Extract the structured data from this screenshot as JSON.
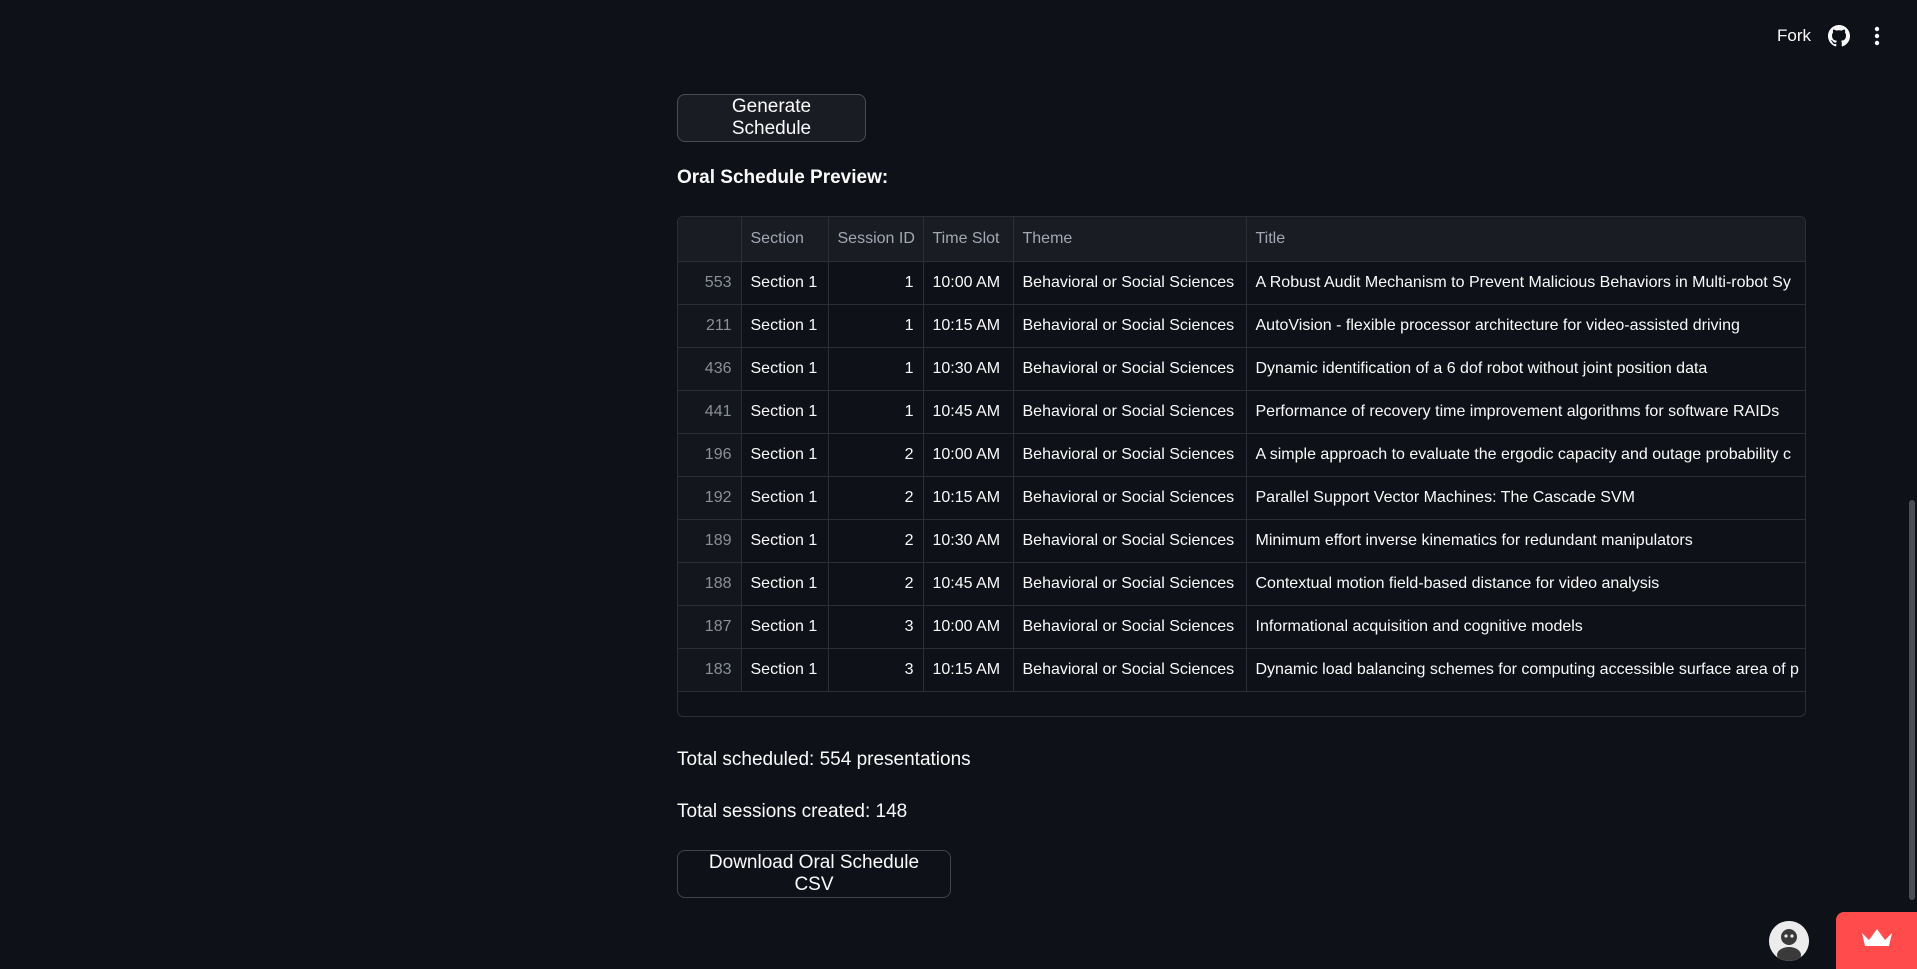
{
  "header": {
    "fork_label": "Fork",
    "github_icon": "github-icon",
    "menu_icon": "kebab-menu-icon"
  },
  "actions": {
    "generate_label": "Generate Schedule",
    "download_label": "Download Oral Schedule CSV"
  },
  "preview": {
    "title": "Oral Schedule Preview:",
    "columns": [
      "",
      "Section",
      "Session ID",
      "Time Slot",
      "Theme",
      "Title"
    ],
    "rows": [
      {
        "index": "553",
        "section": "Section 1",
        "session_id": "1",
        "time_slot": "10:00 AM",
        "theme": "Behavioral or Social Sciences",
        "title": "A Robust Audit Mechanism to Prevent Malicious Behaviors in Multi-robot Sy"
      },
      {
        "index": "211",
        "section": "Section 1",
        "session_id": "1",
        "time_slot": "10:15 AM",
        "theme": "Behavioral or Social Sciences",
        "title": "AutoVision - flexible processor architecture for video-assisted driving"
      },
      {
        "index": "436",
        "section": "Section 1",
        "session_id": "1",
        "time_slot": "10:30 AM",
        "theme": "Behavioral or Social Sciences",
        "title": "Dynamic identification of a 6 dof robot without joint position data"
      },
      {
        "index": "441",
        "section": "Section 1",
        "session_id": "1",
        "time_slot": "10:45 AM",
        "theme": "Behavioral or Social Sciences",
        "title": "Performance of recovery time improvement algorithms for software RAIDs"
      },
      {
        "index": "196",
        "section": "Section 1",
        "session_id": "2",
        "time_slot": "10:00 AM",
        "theme": "Behavioral or Social Sciences",
        "title": "A simple approach to evaluate the ergodic capacity and outage probability c"
      },
      {
        "index": "192",
        "section": "Section 1",
        "session_id": "2",
        "time_slot": "10:15 AM",
        "theme": "Behavioral or Social Sciences",
        "title": "Parallel Support Vector Machines: The Cascade SVM"
      },
      {
        "index": "189",
        "section": "Section 1",
        "session_id": "2",
        "time_slot": "10:30 AM",
        "theme": "Behavioral or Social Sciences",
        "title": "Minimum effort inverse kinematics for redundant manipulators"
      },
      {
        "index": "188",
        "section": "Section 1",
        "session_id": "2",
        "time_slot": "10:45 AM",
        "theme": "Behavioral or Social Sciences",
        "title": "Contextual motion field-based distance for video analysis"
      },
      {
        "index": "187",
        "section": "Section 1",
        "session_id": "3",
        "time_slot": "10:00 AM",
        "theme": "Behavioral or Social Sciences",
        "title": "Informational acquisition and cognitive models"
      },
      {
        "index": "183",
        "section": "Section 1",
        "session_id": "3",
        "time_slot": "10:15 AM",
        "theme": "Behavioral or Social Sciences",
        "title": "Dynamic load balancing schemes for computing accessible surface area of p"
      }
    ]
  },
  "stats": {
    "total_scheduled": "Total scheduled: 554 presentations",
    "total_sessions": "Total sessions created: 148"
  },
  "footer": {
    "avatar_icon": "user-avatar-icon",
    "badge_icon": "crown-icon",
    "badge_color": "#ff4b4b"
  }
}
